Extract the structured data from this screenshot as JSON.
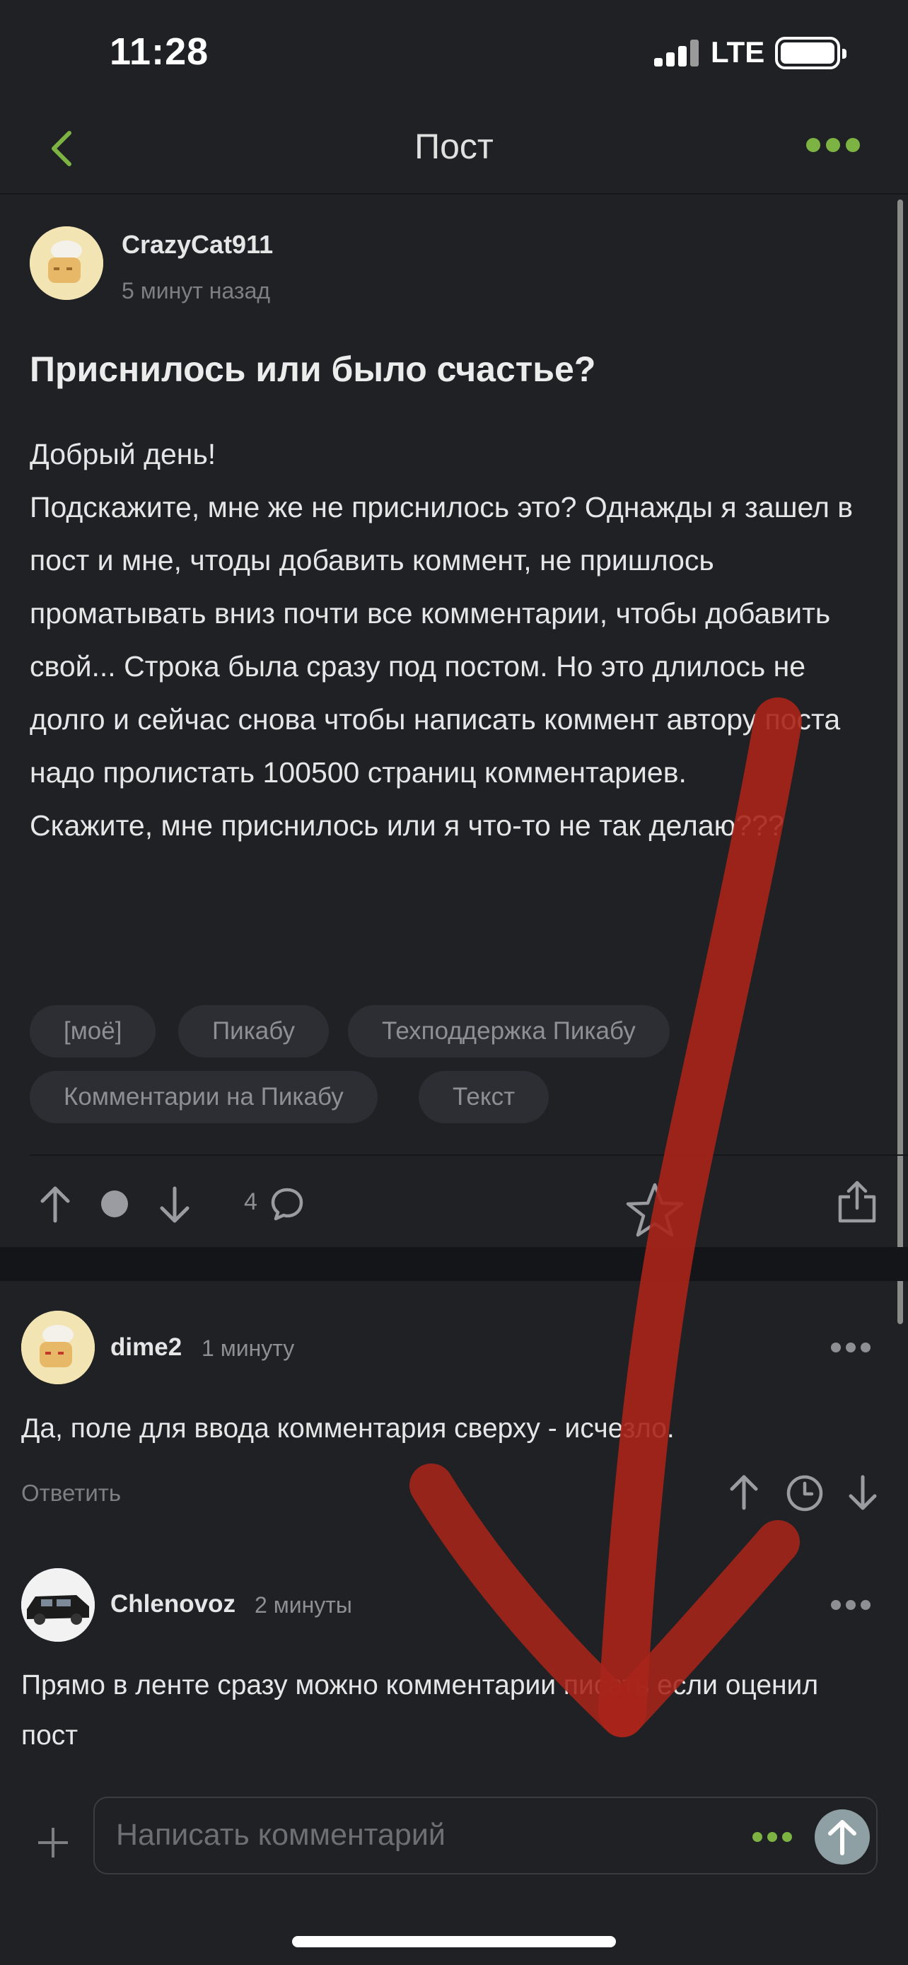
{
  "status_bar": {
    "time": "11:28",
    "network": "LTE"
  },
  "nav": {
    "title": "Пост",
    "back_icon": "chevron-left-icon",
    "more_icon": "more-dots-icon",
    "accent": "#7cb342"
  },
  "post": {
    "author": "CrazyCat911",
    "time": "5 минут назад",
    "title": "Приснилось или было счастье?",
    "body": [
      "Добрый день!",
      "Подскажите, мне же не приснилось это? Однажды я зашел в пост и мне, чтоды добавить коммент, не пришлось проматывать вниз почти все комментарии, чтобы добавить свой... Строка была сразу под постом. Но это длилось не долго и сейчас снова чтобы написать коммент автору поста надо пролистать 100500 страниц комментариев.",
      "Скажите, мне приснилось или я что-то не так делаю???"
    ],
    "tags": [
      "[моё]",
      "Пикабу",
      "Техподдержка Пикабу",
      "Комментарии на Пикабу",
      "Текст"
    ],
    "comment_count": "4"
  },
  "comments": [
    {
      "author": "dime2",
      "time": "1 минуту",
      "text": "Да, поле для ввода комментария сверху - исчезло.",
      "reply_label": "Ответить"
    },
    {
      "author": "Chlenovoz",
      "time": "2 минуты",
      "text": "Прямо в ленте сразу можно комментарии писать если оценил пост"
    }
  ],
  "composer": {
    "placeholder": "Написать комментарий"
  },
  "overlay": {
    "arrow_color": "#b8281c"
  }
}
